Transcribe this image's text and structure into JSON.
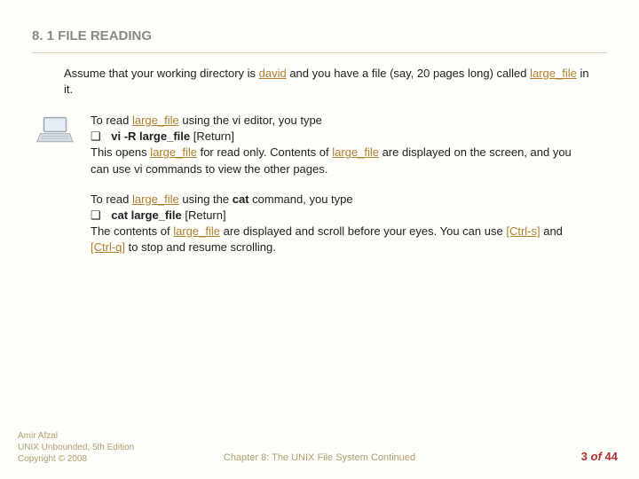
{
  "title": "8. 1 FILE READING",
  "intro": {
    "t1": "Assume that your working directory is ",
    "dir": "david",
    "t2": " and you have a file (say, 20 pages long) called ",
    "file": "large_file",
    "t3": " in it."
  },
  "b1": {
    "l1a": "To read ",
    "l1b": "large_file",
    "l1c": " using the vi editor, you type",
    "bullet": "❑",
    "cmd": "vi -R large_file",
    "ret": " [Return]",
    "l3a": "This opens ",
    "l3b": "large_file",
    "l3c": " for read only. Contents of ",
    "l3d": "large_file",
    "l3e": " are displayed on the screen, and you can use vi commands to view the other pages."
  },
  "b2": {
    "l1a": "To read ",
    "l1b": "large_file",
    "l1c": " using the ",
    "cat": "cat",
    "l1d": " command, you type",
    "bullet": "❑",
    "cmd": "cat large_file",
    "ret": " [Return]",
    "l3a": "The contents of ",
    "l3b": "large_file",
    "l3c": " are displayed and scroll before your eyes. You can use ",
    "k1": "[Ctrl-s]",
    "l3d": " and ",
    "k2": "[Ctrl-q]",
    "l3e": " to stop and resume scrolling."
  },
  "footer": {
    "author": "Amir Afzal",
    "book": "UNIX Unbounded, 5th Edition",
    "copy": "Copyright © 2008"
  },
  "chapter": "Chapter 8: The UNIX File System Continued",
  "page": {
    "cur": "3",
    "of": "of",
    "total": "44"
  }
}
